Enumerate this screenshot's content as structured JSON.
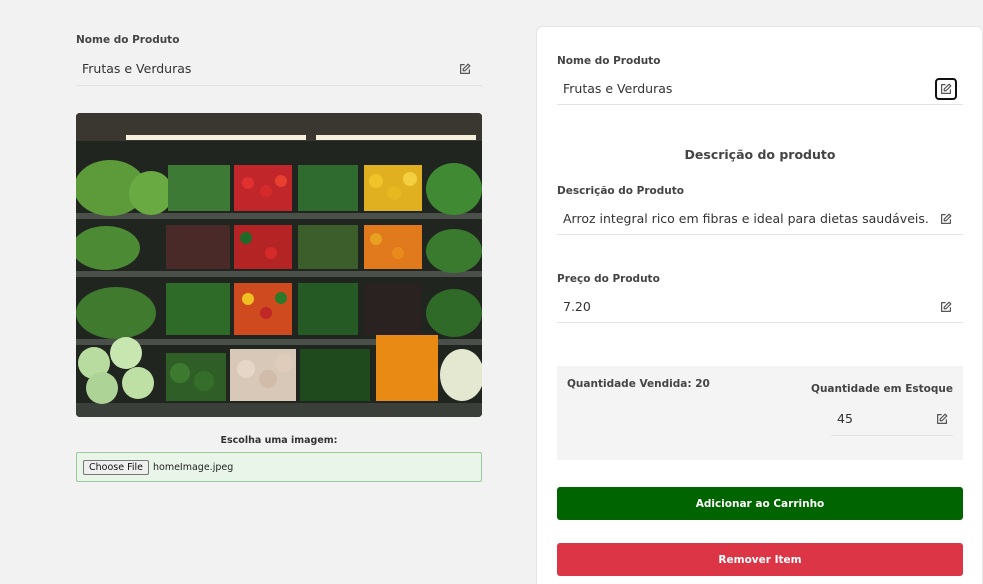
{
  "left": {
    "name_label": "Nome do Produto",
    "name_value": "Frutas e Verduras",
    "file_label": "Escolha uma imagem:",
    "file_button": "Choose File",
    "file_name": "homeImage.jpeg"
  },
  "card": {
    "name_label": "Nome do Produto",
    "name_value": "Frutas e Verduras",
    "section_title": "Descrição do produto",
    "desc_label": "Descrição do Produto",
    "desc_value": "Arroz integral rico em fibras e ideal para dietas saudáveis.",
    "price_label": "Preço do Produto",
    "price_value": "7.20",
    "sold_label": "Quantidade Vendida: 20",
    "stock_label": "Quantidade em Estoque",
    "stock_value": "45",
    "add_button": "Adicionar ao Carrinho",
    "remove_button": "Remover Item"
  },
  "colors": {
    "add_button": "#006400",
    "remove_button": "#dc3545",
    "file_box": "#e8f5e8"
  },
  "icons": {
    "edit": "pencil-square-icon"
  }
}
